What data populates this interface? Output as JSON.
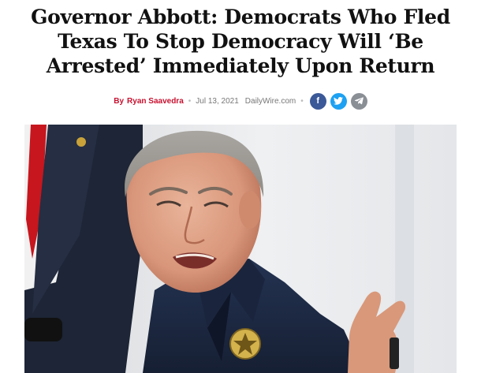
{
  "headline": "Governor Abbott: Democrats Who Fled Texas To Stop Democracy Will ‘Be Arrested’ Immediately Upon Return",
  "byline": {
    "prefix": "By",
    "author": "Ryan Saavedra",
    "separator": "•",
    "date": "Jul 13, 2021",
    "source": "DailyWire.com"
  },
  "share": {
    "facebook": {
      "icon": "facebook-icon",
      "glyph": "f",
      "color": "#3b5998"
    },
    "twitter": {
      "icon": "twitter-icon",
      "color": "#1da1f2"
    },
    "telegram": {
      "icon": "telegram-icon",
      "color": "#8a8f96"
    }
  },
  "colors": {
    "accent": "#c8102e",
    "navy_shirt": "#1f2b44"
  }
}
